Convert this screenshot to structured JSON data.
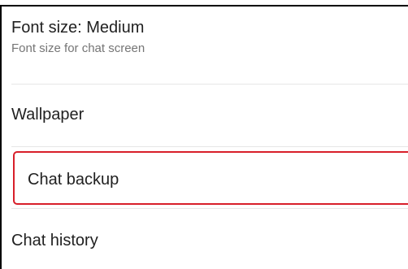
{
  "settings": {
    "font_size": {
      "title": "Font size: Medium",
      "subtitle": "Font size for chat screen"
    },
    "wallpaper": {
      "title": "Wallpaper"
    },
    "chat_backup": {
      "title": "Chat backup",
      "highlight_color": "#d81f2a"
    },
    "chat_history": {
      "title": "Chat history"
    }
  }
}
